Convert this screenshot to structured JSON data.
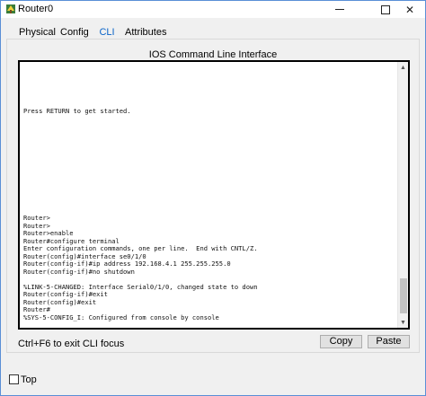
{
  "window": {
    "title": "Router0"
  },
  "tabs": [
    {
      "label": "Physical"
    },
    {
      "label": "Config"
    },
    {
      "label": "CLI",
      "active": true
    },
    {
      "label": "Attributes"
    }
  ],
  "panel": {
    "title": "IOS Command Line Interface"
  },
  "console": {
    "lines": [
      "",
      "",
      "",
      "",
      "",
      "",
      "Press RETURN to get started.",
      "",
      "",
      "",
      "",
      "",
      "",
      "",
      "",
      "",
      "",
      "",
      "",
      "",
      "Router>",
      "Router>",
      "Router>enable",
      "Router#configure terminal",
      "Enter configuration commands, one per line.  End with CNTL/Z.",
      "Router(config)#interface se0/1/0",
      "Router(config-if)#ip address 192.168.4.1 255.255.255.0",
      "Router(config-if)#no shutdown",
      "",
      "%LINK-5-CHANGED: Interface Serial0/1/0, changed state to down",
      "Router(config-if)#exit",
      "Router(config)#exit",
      "Router#",
      "%SYS-5-CONFIG_I: Configured from console by console"
    ]
  },
  "footer": {
    "hint": "Ctrl+F6 to exit CLI focus",
    "copy_label": "Copy",
    "paste_label": "Paste"
  },
  "bottom": {
    "top_label": "Top",
    "top_checked": false
  },
  "colors": {
    "active_tab": "#0a64c8",
    "tab_underline": "#1e7fd2",
    "window_border": "#5a8fd6"
  }
}
